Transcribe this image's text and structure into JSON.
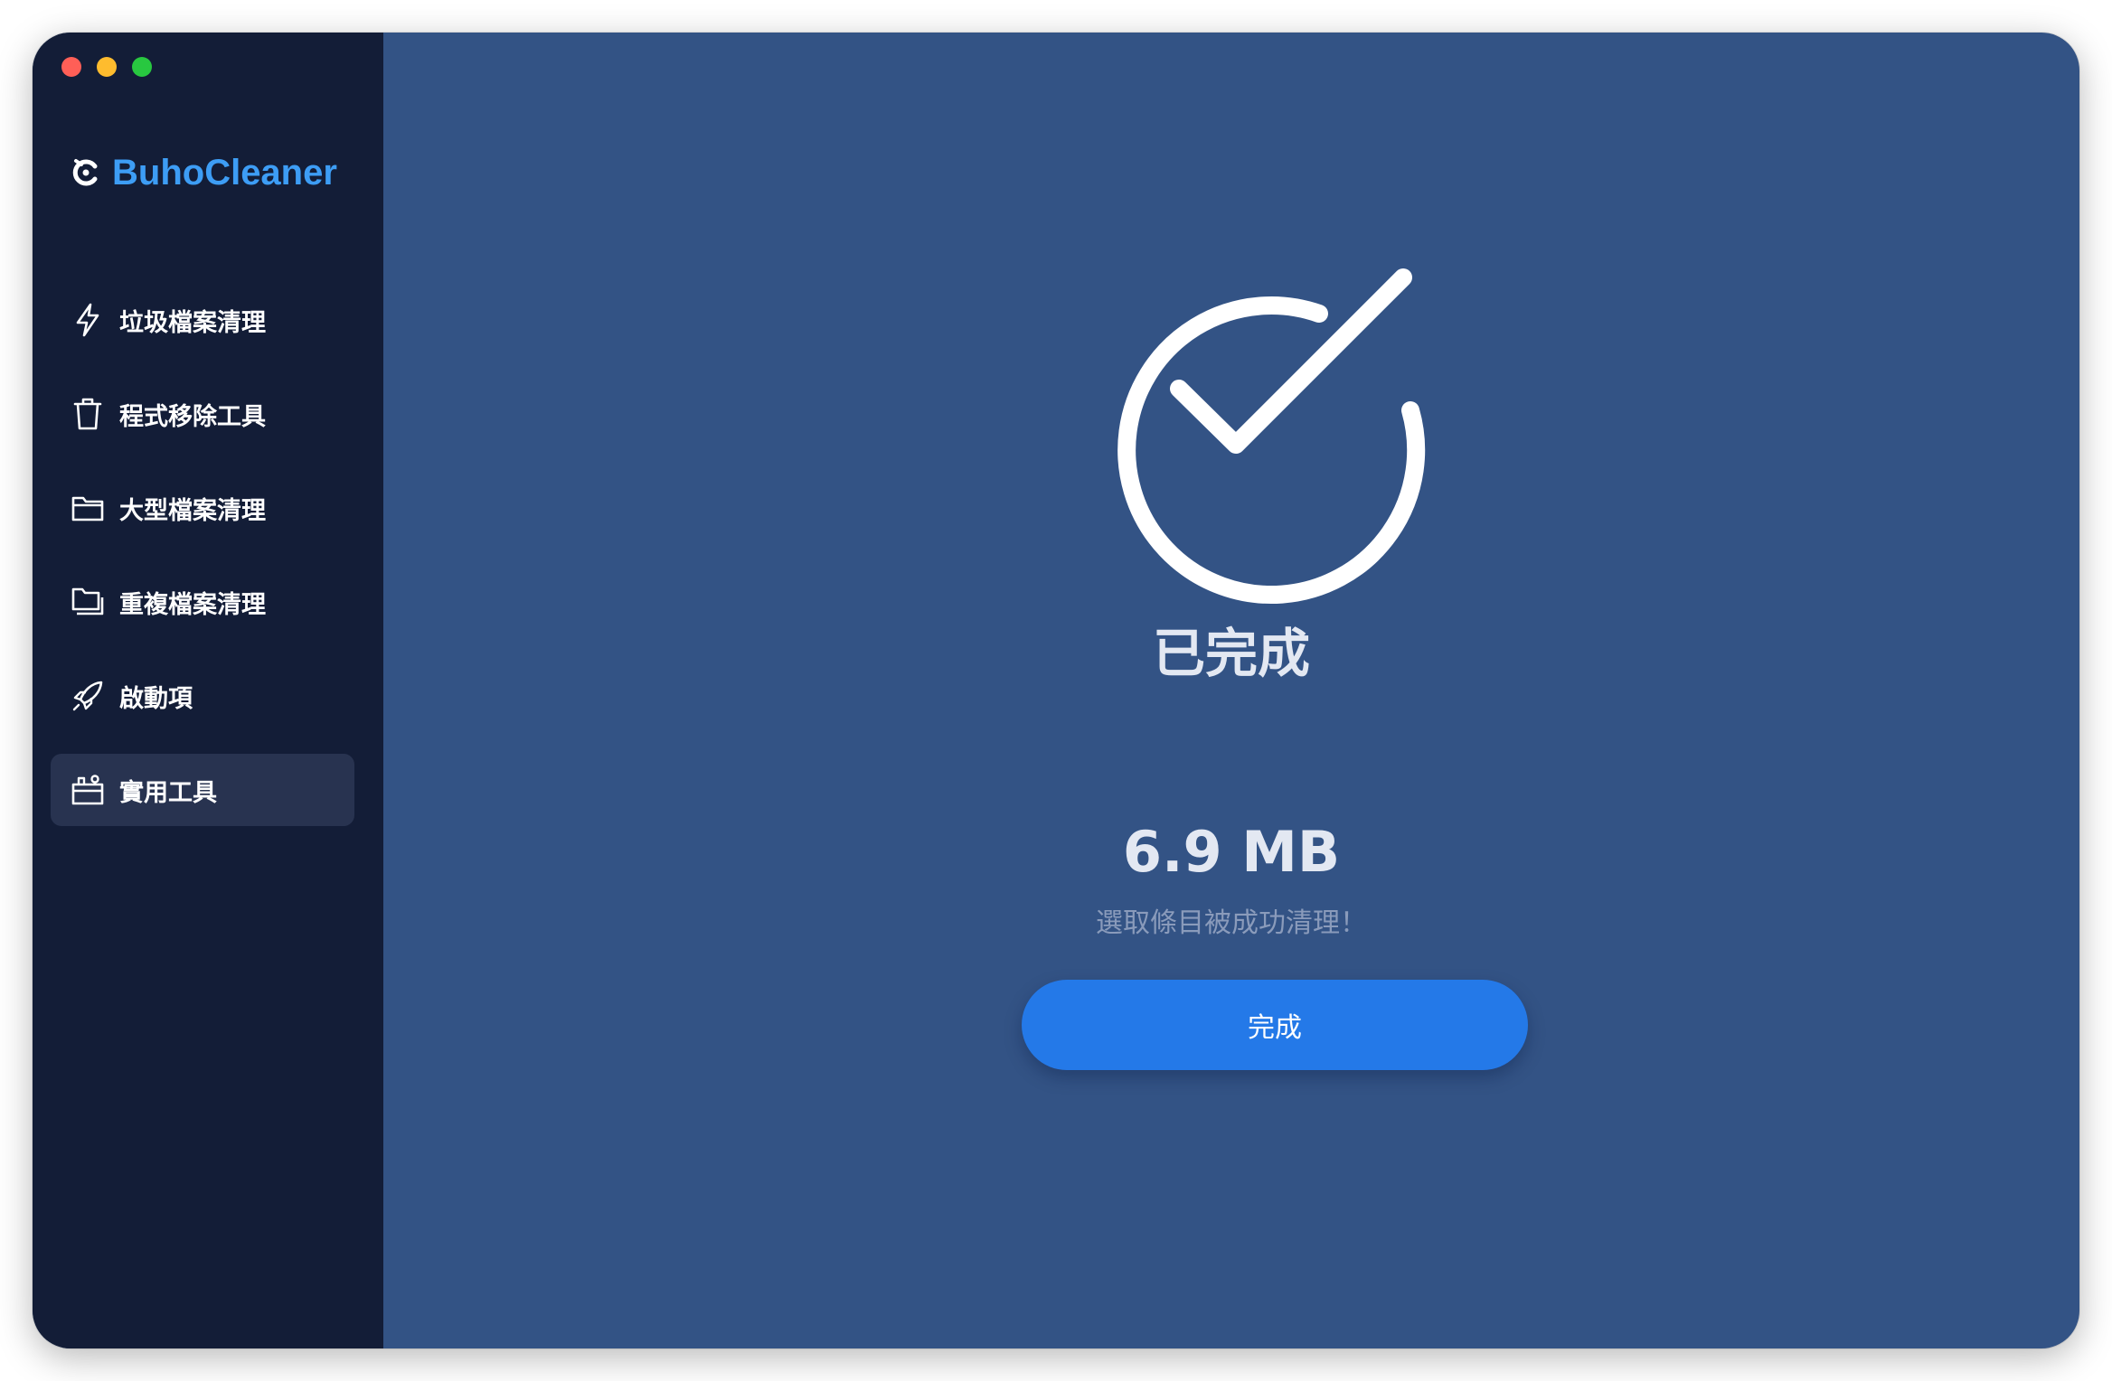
{
  "app": {
    "name": "BuhoCleaner"
  },
  "sidebar": {
    "items": [
      {
        "label": "垃圾檔案清理",
        "icon": "lightning-bolt-icon",
        "active": false
      },
      {
        "label": "程式移除工具",
        "icon": "trash-can-icon",
        "active": false
      },
      {
        "label": "大型檔案清理",
        "icon": "folder-icon",
        "active": false
      },
      {
        "label": "重複檔案清理",
        "icon": "duplicate-folder-icon",
        "active": false
      },
      {
        "label": "啟動項",
        "icon": "rocket-icon",
        "active": false
      },
      {
        "label": "實用工具",
        "icon": "toolbox-icon",
        "active": true
      }
    ]
  },
  "main": {
    "status_title": "已完成",
    "freed_size": "6.9 MB",
    "freed_message": "選取條目被成功清理！",
    "done_button_label": "完成"
  },
  "colors": {
    "sidebar_bg": "#131d37",
    "main_bg": "#335385",
    "brand_blue": "#3d9df5",
    "button_blue": "#2479e8",
    "active_item_bg": "#283350"
  }
}
